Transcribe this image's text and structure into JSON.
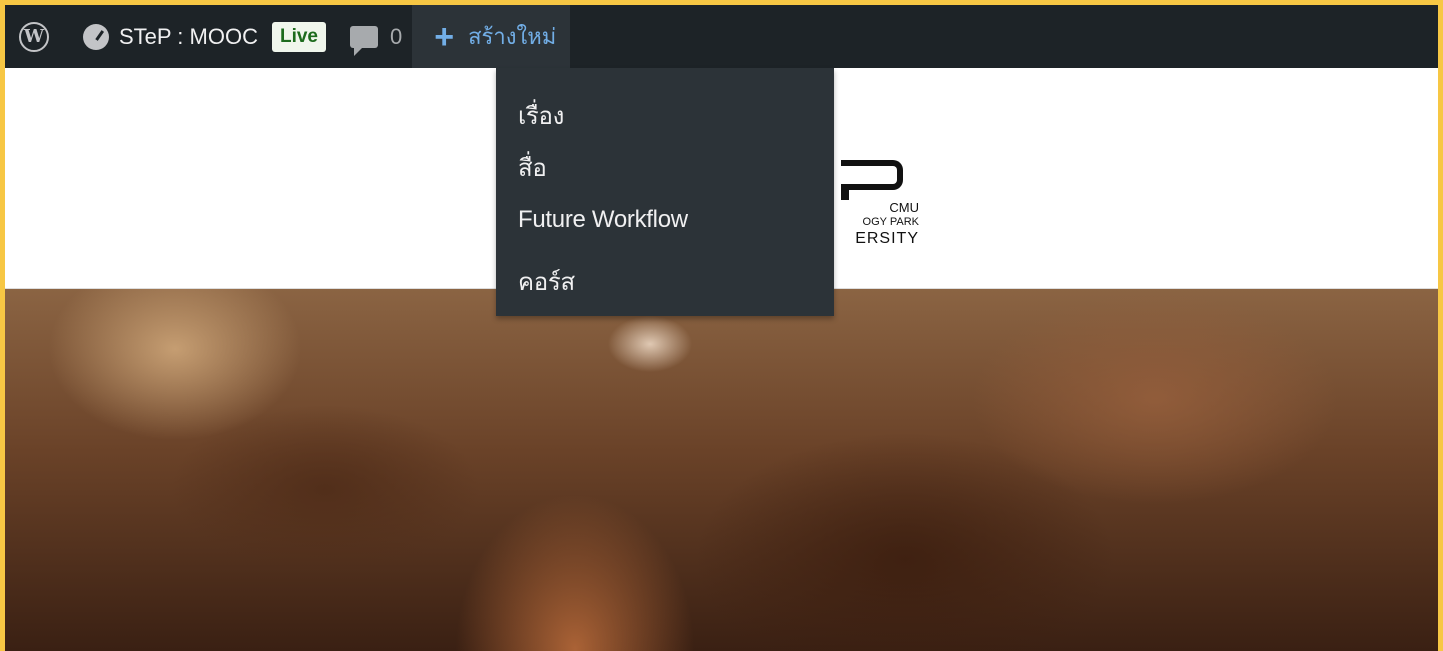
{
  "adminbar": {
    "site_name": "STeP : MOOC",
    "live_badge": "Live",
    "comment_count": "0",
    "new_label": "สร้างใหม่",
    "icons": [
      "wordpress-logo-icon",
      "dashboard-icon",
      "comment-icon",
      "plus-icon"
    ]
  },
  "new_menu": {
    "items": [
      {
        "label": "เรื่อง"
      },
      {
        "label": "สื่อ"
      },
      {
        "label": "Future Workflow"
      },
      {
        "label": "คอร์ส"
      }
    ]
  },
  "logo": {
    "text_cmu": "CMU",
    "text_line2": "OGY PARK",
    "text_line3": "ERSITY"
  },
  "colors": {
    "adminbar_bg": "#1d2327",
    "menu_bg": "#2c3338",
    "accent": "#72aee6",
    "frame_border": "#f7c744"
  }
}
